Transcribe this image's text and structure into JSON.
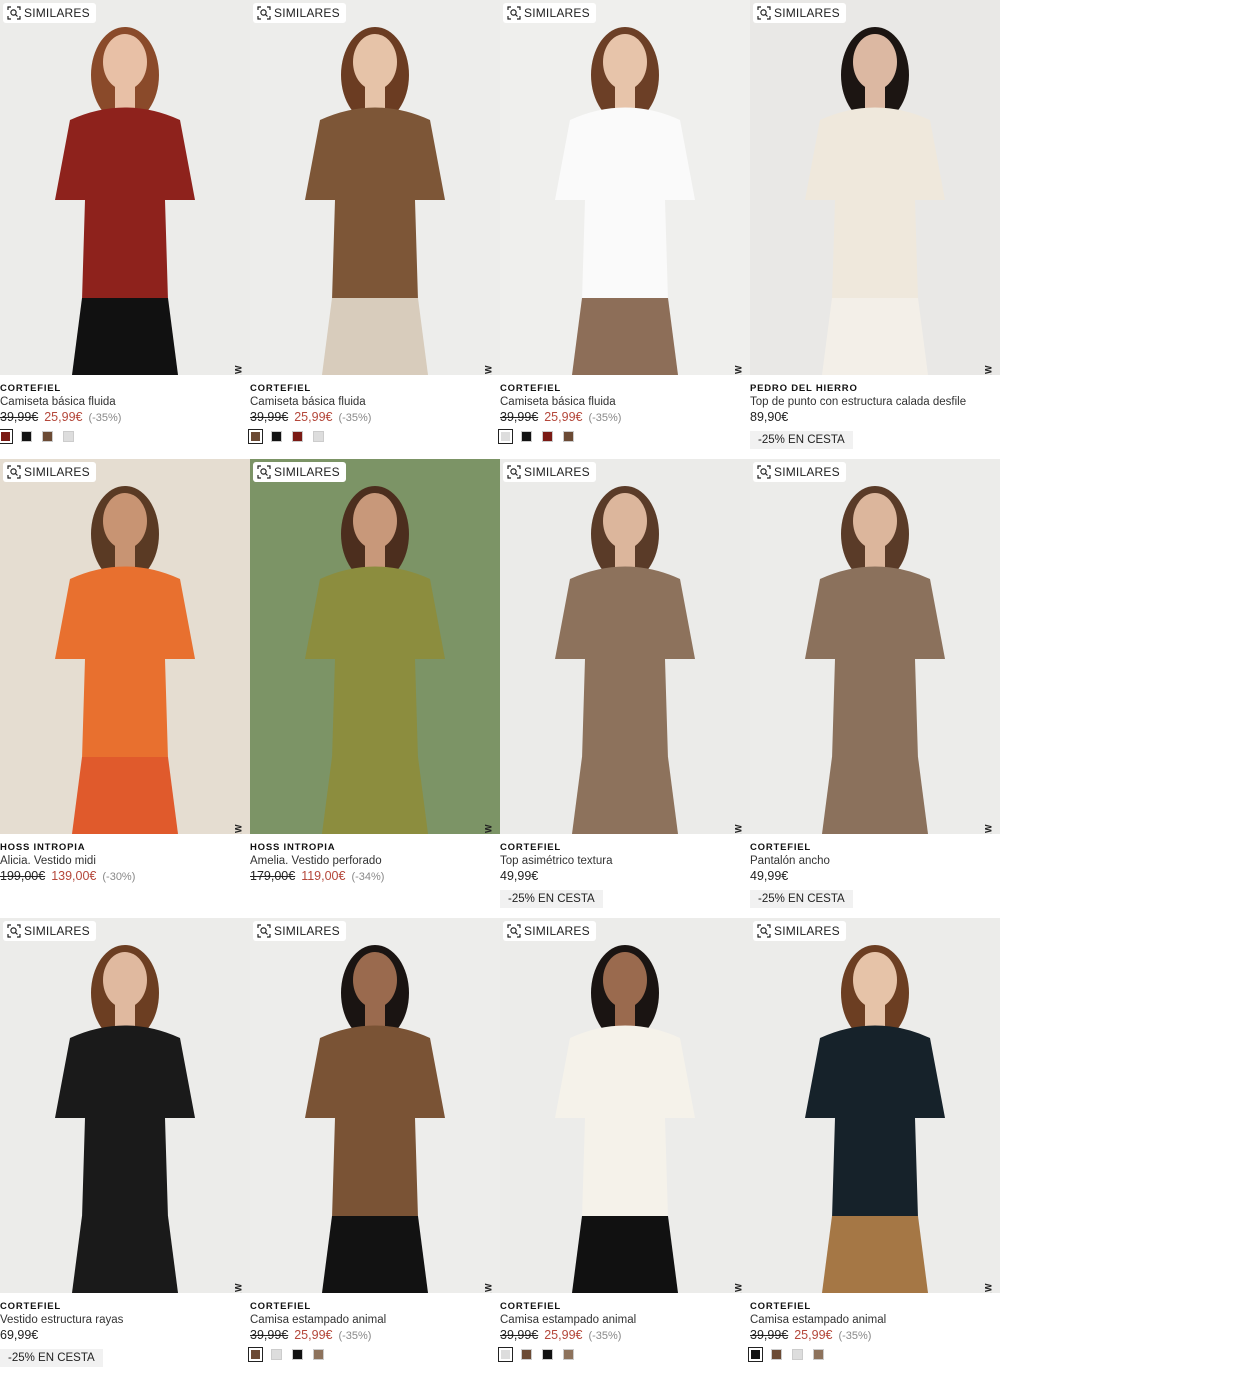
{
  "similar_label": "SIMILARES",
  "new_label": "NEW",
  "products": [
    {
      "brand": "CORTEFIEL",
      "name": "Camiseta básica fluida",
      "old_price": "39,99€",
      "sale_price": "25,99€",
      "discount": "(-35%)",
      "price": "",
      "promo": "",
      "swatches": [
        "#7a1a14",
        "#111111",
        "#6b4a34",
        "#dddddd"
      ],
      "selected": 0,
      "bg": "#ececea",
      "top": "#8e221c",
      "bottom": "#111111",
      "skin": "#e8c0a6",
      "hair": "#8a4a2a"
    },
    {
      "brand": "CORTEFIEL",
      "name": "Camiseta básica fluida",
      "old_price": "39,99€",
      "sale_price": "25,99€",
      "discount": "(-35%)",
      "price": "",
      "promo": "",
      "swatches": [
        "#6b4a34",
        "#111111",
        "#7a1a14",
        "#dddddd"
      ],
      "selected": 0,
      "bg": "#ededeb",
      "top": "#7d5637",
      "bottom": "#d8ccbc",
      "skin": "#e6c3a8",
      "hair": "#6b3c22"
    },
    {
      "brand": "CORTEFIEL",
      "name": "Camiseta básica fluida",
      "old_price": "39,99€",
      "sale_price": "25,99€",
      "discount": "(-35%)",
      "price": "",
      "promo": "",
      "swatches": [
        "#dddddd",
        "#111111",
        "#7a1a14",
        "#6b4a34"
      ],
      "selected": 0,
      "bg": "#efefed",
      "top": "#fafafa",
      "bottom": "#8d6e58",
      "skin": "#e7c4aa",
      "hair": "#6c3f26"
    },
    {
      "brand": "PEDRO DEL HIERRO",
      "name": "Top de punto con estructura calada desfile",
      "old_price": "",
      "sale_price": "",
      "discount": "",
      "price": "89,90€",
      "promo": "-25% EN CESTA",
      "swatches": [],
      "selected": -1,
      "bg": "#e9e8e6",
      "top": "#efe8dc",
      "bottom": "#f3efe8",
      "skin": "#dcb8a2",
      "hair": "#1c1512"
    },
    {
      "brand": "HOSS INTROPIA",
      "name": "Alicia. Vestido midi",
      "old_price": "199,00€",
      "sale_price": "139,00€",
      "discount": "(-30%)",
      "price": "",
      "promo": "",
      "swatches": [],
      "selected": -1,
      "bg": "#e5ddd1",
      "top": "#e8702f",
      "bottom": "#e05a2c",
      "skin": "#c89473",
      "hair": "#5a3a24"
    },
    {
      "brand": "HOSS INTROPIA",
      "name": "Amelia. Vestido perforado",
      "old_price": "179,00€",
      "sale_price": "119,00€",
      "discount": "(-34%)",
      "price": "",
      "promo": "",
      "swatches": [],
      "selected": -1,
      "bg": "#7c9466",
      "top": "#8c8d3e",
      "bottom": "#8c8d3e",
      "skin": "#c8987a",
      "hair": "#4c2e1e"
    },
    {
      "brand": "CORTEFIEL",
      "name": "Top asimétrico textura",
      "old_price": "",
      "sale_price": "",
      "discount": "",
      "price": "49,99€",
      "promo": "-25% EN CESTA",
      "swatches": [],
      "selected": -1,
      "bg": "#ebebe9",
      "top": "#8d725c",
      "bottom": "#8d725c",
      "skin": "#dcb69c",
      "hair": "#5a3b28"
    },
    {
      "brand": "CORTEFIEL",
      "name": "Pantalón ancho",
      "old_price": "",
      "sale_price": "",
      "discount": "",
      "price": "49,99€",
      "promo": "-25% EN CESTA",
      "swatches": [],
      "selected": -1,
      "bg": "#ececea",
      "top": "#8b715c",
      "bottom": "#8b715c",
      "skin": "#dcb69c",
      "hair": "#5a3b28"
    },
    {
      "brand": "CORTEFIEL",
      "name": "Vestido estructura rayas",
      "old_price": "",
      "sale_price": "",
      "discount": "",
      "price": "69,99€",
      "promo": "-25% EN CESTA",
      "swatches": [],
      "selected": -1,
      "bg": "#ececea",
      "top": "#1a1a1a",
      "bottom": "#1a1a1a",
      "skin": "#e0b99f",
      "hair": "#6c3e22"
    },
    {
      "brand": "CORTEFIEL",
      "name": "Camisa estampado animal",
      "old_price": "39,99€",
      "sale_price": "25,99€",
      "discount": "(-35%)",
      "price": "",
      "promo": "",
      "swatches": [
        "#6b4a34",
        "#dddddd",
        "#111111",
        "#8d725c"
      ],
      "selected": 0,
      "bg": "#ededeb",
      "top": "#7a5335",
      "bottom": "#121212",
      "skin": "#9a6a4e",
      "hair": "#1a1412"
    },
    {
      "brand": "CORTEFIEL",
      "name": "Camisa estampado animal",
      "old_price": "39,99€",
      "sale_price": "25,99€",
      "discount": "(-35%)",
      "price": "",
      "promo": "",
      "swatches": [
        "#dddddd",
        "#6b4a34",
        "#111111",
        "#8d725c"
      ],
      "selected": 0,
      "bg": "#ececea",
      "top": "#f5f2ea",
      "bottom": "#111111",
      "skin": "#9a6a4e",
      "hair": "#1a1412"
    },
    {
      "brand": "CORTEFIEL",
      "name": "Camisa estampado animal",
      "old_price": "39,99€",
      "sale_price": "25,99€",
      "discount": "(-35%)",
      "price": "",
      "promo": "",
      "swatches": [
        "#111111",
        "#6b4a34",
        "#dddddd",
        "#8d725c"
      ],
      "selected": 0,
      "bg": "#ececea",
      "top": "#16222a",
      "bottom": "#a57745",
      "skin": "#e6c3a8",
      "hair": "#6c3e22"
    }
  ]
}
